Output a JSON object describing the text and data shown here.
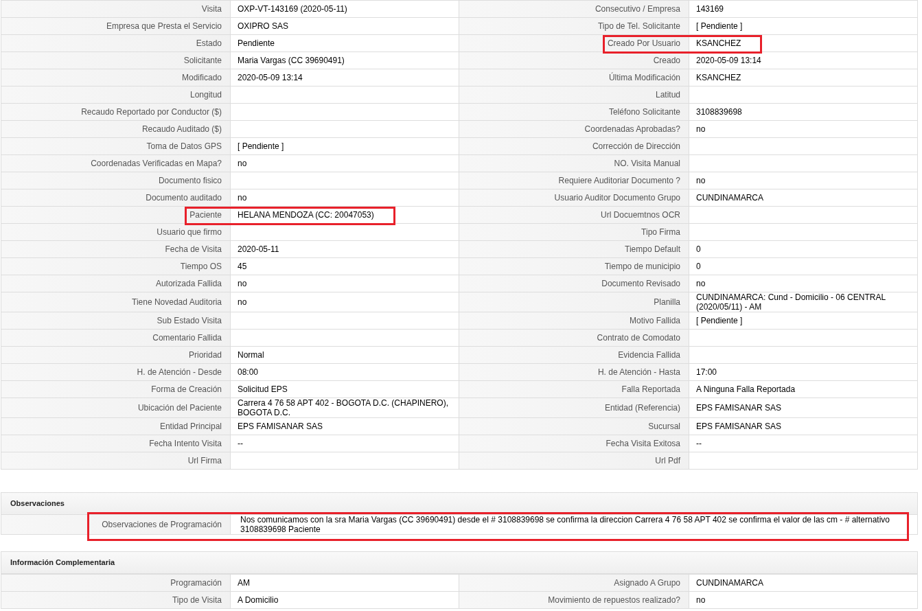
{
  "details": {
    "rows": [
      {
        "left": {
          "label": "Visita",
          "value": "OXP-VT-143169 (2020-05-11)",
          "highlighted": false
        },
        "right": {
          "label": "Consecutivo / Empresa",
          "value": "143169",
          "highlighted": false
        }
      },
      {
        "left": {
          "label": "Empresa que Presta el Servicio",
          "value": "OXIPRO SAS",
          "highlighted": false
        },
        "right": {
          "label": "Tipo de Tel. Solicitante",
          "value": "[ Pendiente ]",
          "highlighted": false
        }
      },
      {
        "left": {
          "label": "Estado",
          "value": "Pendiente",
          "highlighted": false
        },
        "right": {
          "label": "Creado Por Usuario",
          "value": "KSANCHEZ",
          "highlighted": true
        }
      },
      {
        "left": {
          "label": "Solicitante",
          "value": "Maria Vargas (CC 39690491)",
          "highlighted": false
        },
        "right": {
          "label": "Creado",
          "value": "2020-05-09 13:14",
          "highlighted": false
        }
      },
      {
        "left": {
          "label": "Modificado",
          "value": "2020-05-09 13:14",
          "highlighted": false
        },
        "right": {
          "label": "Última Modificación",
          "value": "KSANCHEZ",
          "highlighted": false
        }
      },
      {
        "left": {
          "label": "Longitud",
          "highlighted": false
        },
        "right": {
          "label": "Latitud",
          "highlighted": false
        }
      },
      {
        "left": {
          "label": "Recaudo Reportado por Conductor ($)",
          "highlighted": false
        },
        "right": {
          "label": "Teléfono Solicitante",
          "value": "3108839698",
          "highlighted": false
        }
      },
      {
        "left": {
          "label": "Recaudo Auditado ($)",
          "highlighted": false
        },
        "right": {
          "label": "Coordenadas Aprobadas?",
          "value": "no",
          "highlighted": false
        }
      },
      {
        "left": {
          "label": "Toma de Datos GPS",
          "value": "[ Pendiente ]",
          "highlighted": false
        },
        "right": {
          "label": "Corrección de Dirección",
          "highlighted": false
        }
      },
      {
        "left": {
          "label": "Coordenadas Verificadas en Mapa?",
          "value": "no",
          "highlighted": false
        },
        "right": {
          "label": "NO. Visita Manual",
          "highlighted": false
        }
      },
      {
        "left": {
          "label": "Documento fisico",
          "highlighted": false
        },
        "right": {
          "label": "Requiere Auditoriar Documento ?",
          "value": "no",
          "highlighted": false
        }
      },
      {
        "left": {
          "label": "Documento auditado",
          "value": "no",
          "highlighted": false
        },
        "right": {
          "label": "Usuario Auditor Documento Grupo",
          "value": "CUNDINAMARCA",
          "highlighted": false
        }
      },
      {
        "left": {
          "label": "Paciente",
          "value": "HELANA MENDOZA (CC: 20047053)",
          "highlighted": true
        },
        "right": {
          "label": "Url Docuemtnos OCR",
          "highlighted": false
        }
      },
      {
        "left": {
          "label": "Usuario que firmo",
          "highlighted": false
        },
        "right": {
          "label": "Tipo Firma",
          "highlighted": false
        }
      },
      {
        "left": {
          "label": "Fecha de Visita",
          "value": "2020-05-11",
          "highlighted": false
        },
        "right": {
          "label": "Tiempo Default",
          "value": "0",
          "highlighted": false
        }
      },
      {
        "left": {
          "label": "Tiempo OS",
          "value": "45",
          "highlighted": false
        },
        "right": {
          "label": "Tiempo de municipio",
          "value": "0",
          "highlighted": false
        }
      },
      {
        "left": {
          "label": "Autorizada Fallida",
          "value": "no",
          "highlighted": false
        },
        "right": {
          "label": "Documento Revisado",
          "value": "no",
          "highlighted": false
        }
      },
      {
        "left": {
          "label": "Tiene Novedad Auditoria",
          "value": "no",
          "highlighted": false
        },
        "right": {
          "label": "Planilla",
          "value": "CUNDINAMARCA: Cund - Domicilio - 06 CENTRAL (2020/05/11) - AM",
          "highlighted": false
        }
      },
      {
        "left": {
          "label": "Sub Estado Visita",
          "highlighted": false
        },
        "right": {
          "label": "Motivo Fallida",
          "value": "[ Pendiente ]",
          "highlighted": false
        }
      },
      {
        "left": {
          "label": "Comentario Fallida",
          "highlighted": false
        },
        "right": {
          "label": "Contrato de Comodato",
          "highlighted": false
        }
      },
      {
        "left": {
          "label": "Prioridad",
          "value": "Normal",
          "highlighted": false
        },
        "right": {
          "label": "Evidencia Fallida",
          "highlighted": false
        }
      },
      {
        "left": {
          "label": "H. de Atención - Desde",
          "value": "08:00",
          "highlighted": false
        },
        "right": {
          "label": "H. de Atención - Hasta",
          "value": "17:00",
          "highlighted": false
        }
      },
      {
        "left": {
          "label": "Forma de Creación",
          "value": "Solicitud EPS",
          "highlighted": false
        },
        "right": {
          "label": "Falla Reportada",
          "value": "A Ninguna Falla Reportada",
          "highlighted": false
        }
      },
      {
        "left": {
          "label": "Ubicación del Paciente",
          "value": "Carrera 4 76 58 APT 402 - BOGOTA D.C. (CHAPINERO), BOGOTA D.C.",
          "highlighted": false
        },
        "right": {
          "label": "Entidad (Referencia)",
          "value": "EPS FAMISANAR SAS",
          "highlighted": false
        }
      },
      {
        "left": {
          "label": "Entidad Principal",
          "value": "EPS FAMISANAR SAS",
          "highlighted": false
        },
        "right": {
          "label": "Sucursal",
          "value": "EPS FAMISANAR SAS",
          "highlighted": false
        }
      },
      {
        "left": {
          "label": "Fecha Intento Visita",
          "value": "--",
          "highlighted": false
        },
        "right": {
          "label": "Fecha Visita Exitosa",
          "value": "--",
          "highlighted": false
        }
      },
      {
        "left": {
          "label": "Url Firma",
          "highlighted": false
        },
        "right": {
          "label": "Url Pdf",
          "highlighted": false
        }
      }
    ]
  },
  "observaciones": {
    "title": "Observaciones",
    "rows": [
      {
        "label": "Observaciones de Programación",
        "value": "Nos comunicamos con la sra Maria Vargas (CC 39690491) desde el # 3108839698 se confirma la direccion Carrera 4 76 58 APT 402 se confirma el valor de las cm - # alternativo 3108839698 Paciente",
        "highlighted": true
      }
    ]
  },
  "informacion_complementaria": {
    "title": "Información Complementaria",
    "rows": [
      {
        "left": {
          "label": "Programación",
          "value": "AM",
          "highlighted": false
        },
        "right": {
          "label": "Asignado A Grupo",
          "value": "CUNDINAMARCA",
          "highlighted": false
        }
      },
      {
        "left": {
          "label": "Tipo de Visita",
          "value": "A Domicilio",
          "highlighted": false
        },
        "right": {
          "label": "Movimiento de repuestos realizado?",
          "value": "no",
          "highlighted": false
        }
      }
    ]
  }
}
